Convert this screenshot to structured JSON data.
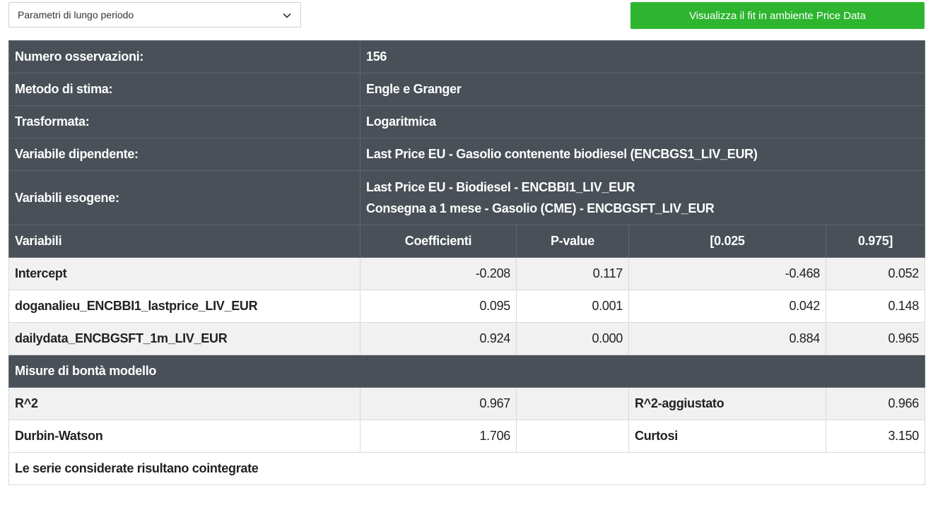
{
  "selector": {
    "selected": "Parametri di lungo periodo"
  },
  "actions": {
    "fit_button": "Visualizza il fit in ambiente Price Data"
  },
  "info": {
    "observations_label": "Numero osservazioni:",
    "observations_value": "156",
    "method_label": "Metodo di stima:",
    "method_value": "Engle e Granger",
    "transform_label": "Trasformata:",
    "transform_value": "Logaritmica",
    "dependent_label": "Variabile dipendente:",
    "dependent_value": "Last Price EU - Gasolio contenente biodiesel (ENCBGS1_LIV_EUR)",
    "exogenous_label": "Variabili esogene:",
    "exogenous_values": [
      "Last Price EU - Biodiesel - ENCBBI1_LIV_EUR",
      "Consegna a 1 mese - Gasolio (CME) - ENCBGSFT_LIV_EUR"
    ]
  },
  "coefficients": {
    "headers": [
      "Variabili",
      "Coefficienti",
      "P-value",
      "[0.025",
      "0.975]"
    ],
    "rows": [
      {
        "name": "Intercept",
        "coef": "-0.208",
        "pvalue": "0.117",
        "low": "-0.468",
        "high": "0.052"
      },
      {
        "name": "doganalieu_ENCBBI1_lastprice_LIV_EUR",
        "coef": "0.095",
        "pvalue": "0.001",
        "low": "0.042",
        "high": "0.148"
      },
      {
        "name": "dailydata_ENCBGSFT_1m_LIV_EUR",
        "coef": "0.924",
        "pvalue": "0.000",
        "low": "0.884",
        "high": "0.965"
      }
    ]
  },
  "goodness": {
    "title": "Misure di bontà modello",
    "r2_label": "R^2",
    "r2_value": "0.967",
    "r2adj_label": "R^2-aggiustato",
    "r2adj_value": "0.966",
    "dw_label": "Durbin-Watson",
    "dw_value": "1.706",
    "kurt_label": "Curtosi",
    "kurt_value": "3.150",
    "conclusion": "Le serie considerate risultano cointegrate"
  },
  "icons": {
    "select_arrow": "chevron-down-icon"
  },
  "colors": {
    "header_bg": "#495057",
    "button_bg": "#2db52f",
    "row_light": "#f1f1f1"
  }
}
